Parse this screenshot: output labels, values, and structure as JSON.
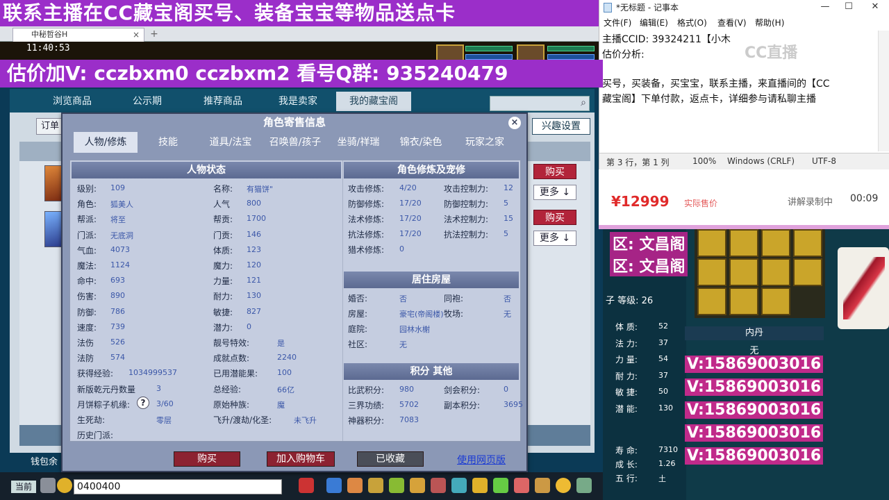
{
  "banner": {
    "top": "联系主播在CC藏宝阁买号、装备宝宝等物品送点卡",
    "price_line": "估价加V:   cczbxm0   cczbxm2   看号Q群: 935240479"
  },
  "browser": {
    "tab_title": "中秘哲谷H",
    "close_icon": "×",
    "add_icon": "+"
  },
  "game": {
    "time": "11:40:53",
    "nav_tabs": [
      "浏览商品",
      "公示期",
      "推荐商品",
      "我是卖家",
      "我的藏宝阁"
    ],
    "order_label": "订单",
    "interest_label": "兴趣设置",
    "list_buttons": {
      "buy": "购买",
      "more": "更多 ↓"
    },
    "wallet_label": "钱包余",
    "chat_channel": "当前",
    "chat_value": "0400400"
  },
  "modal": {
    "title": "角色寄售信息",
    "close_icon": "×",
    "tabs": [
      "人物/修炼",
      "技能",
      "道具/法宝",
      "召唤兽/孩子",
      "坐骑/祥瑞",
      "锦衣/染色",
      "玩家之家"
    ],
    "status": {
      "header": "人物状态",
      "left": [
        {
          "label": "级别:",
          "value": "109"
        },
        {
          "label": "角色:",
          "value": "狐美人"
        },
        {
          "label": "帮派:",
          "value": "将至"
        },
        {
          "label": "门派:",
          "value": "无底洞"
        },
        {
          "label": "气血:",
          "value": "4073"
        },
        {
          "label": "魔法:",
          "value": "1124"
        },
        {
          "label": "命中:",
          "value": "693"
        },
        {
          "label": "伤害:",
          "value": "890"
        },
        {
          "label": "防御:",
          "value": "786"
        },
        {
          "label": "速度:",
          "value": "739"
        },
        {
          "label": "法伤",
          "value": "526"
        },
        {
          "label": "法防",
          "value": "574"
        },
        {
          "label": "获得经验:",
          "value": "1034999537"
        },
        {
          "label": "新版乾元丹数量",
          "value": "3"
        },
        {
          "label": "月饼粽子机缘:",
          "value": "3/60"
        },
        {
          "label": "生死劫:",
          "value": "零层"
        },
        {
          "label": "历史门派:",
          "value": ""
        }
      ],
      "right": [
        {
          "label": "名称:",
          "value": "有猫饼\""
        },
        {
          "label": "人气",
          "value": "800"
        },
        {
          "label": "帮贡:",
          "value": "1700"
        },
        {
          "label": "门贡:",
          "value": "146"
        },
        {
          "label": "体质:",
          "value": "123"
        },
        {
          "label": "魔力:",
          "value": "120"
        },
        {
          "label": "力量:",
          "value": "121"
        },
        {
          "label": "耐力:",
          "value": "130"
        },
        {
          "label": "敏捷:",
          "value": "827"
        },
        {
          "label": "潜力:",
          "value": "0"
        },
        {
          "label": "靓号特效:",
          "value": "是"
        },
        {
          "label": "成就点数:",
          "value": "2240"
        },
        {
          "label": "已用潜能果:",
          "value": "100"
        },
        {
          "label": "总经验:",
          "value": "66亿"
        },
        {
          "label": "原始种族:",
          "value": "魔"
        },
        {
          "label": "飞升/渡劫/化圣:",
          "value": "未飞升"
        }
      ],
      "help_icon": "?"
    },
    "cultivation": {
      "header": "角色修炼及宠修",
      "rows": [
        {
          "l1": "攻击修炼:",
          "v1": "4/20",
          "l2": "攻击控制力:",
          "v2": "12"
        },
        {
          "l1": "防御修炼:",
          "v1": "17/20",
          "l2": "防御控制力:",
          "v2": "5"
        },
        {
          "l1": "法术修炼:",
          "v1": "17/20",
          "l2": "法术控制力:",
          "v2": "15"
        },
        {
          "l1": "抗法修炼:",
          "v1": "17/20",
          "l2": "抗法控制力:",
          "v2": "5"
        },
        {
          "l1": "猎术修炼:",
          "v1": "0",
          "l2": "",
          "v2": ""
        }
      ]
    },
    "housing": {
      "header": "居住房屋",
      "rows": [
        {
          "l1": "婚否:",
          "v1": "否",
          "l2": "同袍:",
          "v2": "否"
        },
        {
          "l1": "房屋:",
          "v1": "豪宅(帝阁楼)",
          "l2": "牧场:",
          "v2": "无"
        },
        {
          "l1": "庭院:",
          "v1": "园林水榭",
          "l2": "",
          "v2": ""
        },
        {
          "l1": "社区:",
          "v1": "无",
          "l2": "",
          "v2": ""
        }
      ]
    },
    "points": {
      "header": "积分 其他",
      "rows": [
        {
          "l1": "比武积分:",
          "v1": "980",
          "l2": "剑会积分:",
          "v2": "0"
        },
        {
          "l1": "三界功绩:",
          "v1": "5702",
          "l2": "副本积分:",
          "v2": "3695"
        },
        {
          "l1": "神器积分:",
          "v1": "7083",
          "l2": "",
          "v2": ""
        }
      ]
    },
    "buttons": {
      "buy": "购买",
      "cart": "加入购物车",
      "fav": "已收藏",
      "web": "使用网页版"
    }
  },
  "notepad": {
    "title": "*无标题 - 记事本",
    "window_controls": [
      "—",
      "☐",
      "✕"
    ],
    "menu": [
      "文件(F)",
      "编辑(E)",
      "格式(O)",
      "查看(V)",
      "帮助(H)"
    ],
    "lines": [
      "主播CCID: 39324211【小木",
      "估价分析:",
      "",
      "买号，买装备，买宝宝，联系主播，来直播间的【CC",
      "藏宝阁】下单付款，返点卡，详细参与请私聊主播"
    ],
    "status": [
      "第 3 行，第 1 列",
      "100%",
      "Windows (CRLF)",
      "UTF-8"
    ],
    "watermark": "CC直播"
  },
  "commerce": {
    "price": "¥12999",
    "price_note": "实际售价",
    "recording": "讲解录制中",
    "rec_time": "00:09"
  },
  "video": {
    "zones": [
      "区: 文昌阁",
      "区: 文昌阁"
    ],
    "level": "子 等级: 26",
    "stats": [
      {
        "label": "体    质:",
        "value": "52"
      },
      {
        "label": "法    力:",
        "value": "37"
      },
      {
        "label": "力    量:",
        "value": "54"
      },
      {
        "label": "耐    力:",
        "value": "37"
      },
      {
        "label": "敏    捷:",
        "value": "50"
      },
      {
        "label": "潜    能:",
        "value": "130"
      }
    ],
    "bottom_stats": [
      {
        "label": "寿    命:",
        "value": "7310"
      },
      {
        "label": "成    长:",
        "value": "1.26"
      },
      {
        "label": "五    行:",
        "value": "土"
      }
    ],
    "skill_title": "内丹",
    "skill_none": "无",
    "vnums": [
      "V:15869003016",
      "V:15869003016",
      "V:15869003016",
      "V:15869003016",
      "V:15869003016"
    ]
  }
}
